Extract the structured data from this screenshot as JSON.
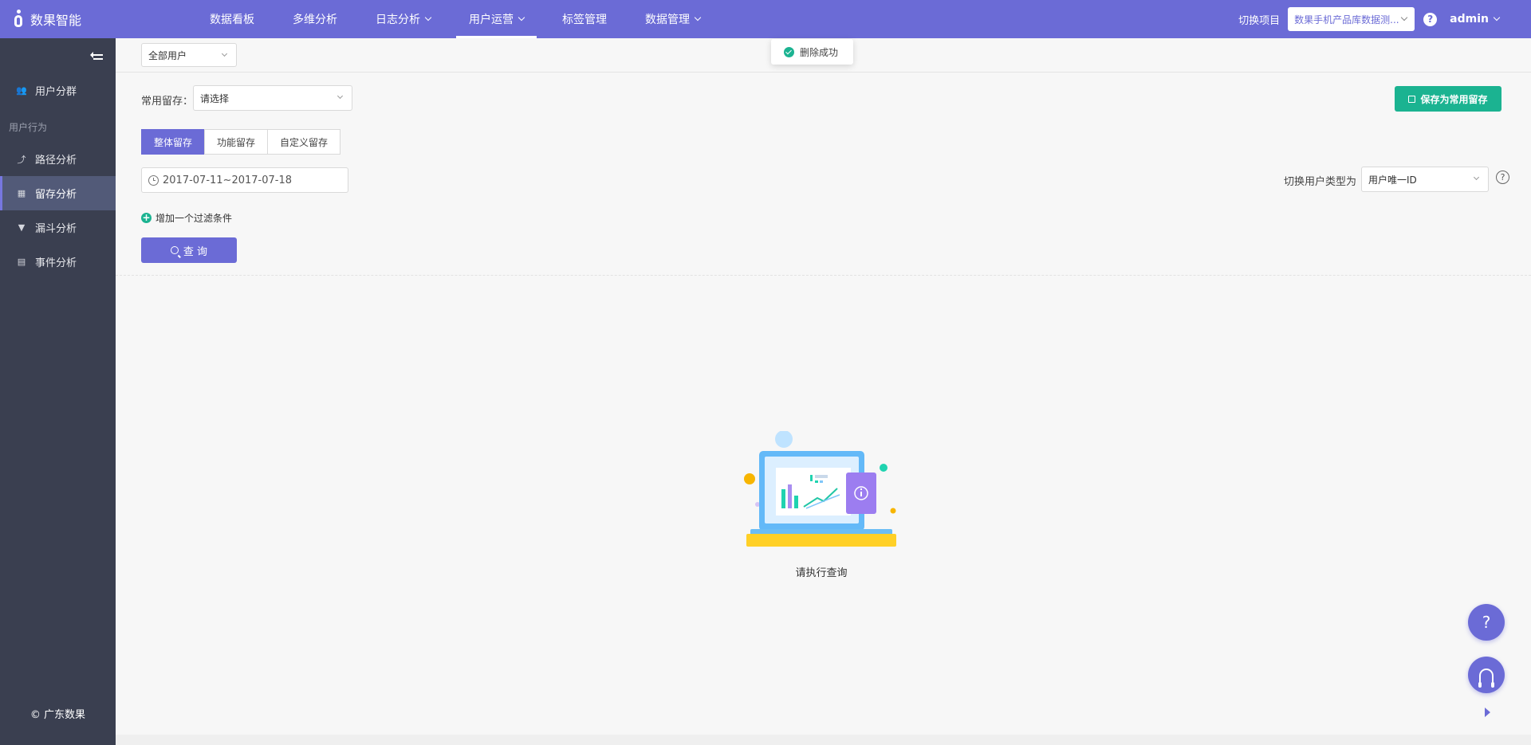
{
  "app": {
    "name": "数果智能"
  },
  "nav": {
    "items": [
      {
        "label": "数据看板",
        "has_dropdown": false,
        "active": false
      },
      {
        "label": "多维分析",
        "has_dropdown": false,
        "active": false
      },
      {
        "label": "日志分析",
        "has_dropdown": true,
        "active": false
      },
      {
        "label": "用户运营",
        "has_dropdown": true,
        "active": true
      },
      {
        "label": "标签管理",
        "has_dropdown": false,
        "active": false
      },
      {
        "label": "数据管理",
        "has_dropdown": true,
        "active": false
      }
    ]
  },
  "header_right": {
    "switch_project_label": "切换项目",
    "project_value": "数果手机产品库数据测...",
    "help_icon": "question-circle-icon",
    "user": "admin"
  },
  "sidebar": {
    "items": [
      {
        "label": "用户分群",
        "icon": "users-icon",
        "active": false
      },
      {
        "label": "路径分析",
        "icon": "path-icon",
        "active": false
      },
      {
        "label": "留存分析",
        "icon": "retention-icon",
        "active": true
      },
      {
        "label": "漏斗分析",
        "icon": "funnel-icon",
        "active": false
      },
      {
        "label": "事件分析",
        "icon": "event-icon",
        "active": false
      }
    ],
    "group_label": "用户行为",
    "copyright": "© 广东数果"
  },
  "toolbar": {
    "user_filter": "全部用户"
  },
  "toast": {
    "message": "删除成功",
    "icon": "check-circle-icon"
  },
  "form": {
    "common_retention_label": "常用留存：",
    "common_retention_placeholder": "请选择",
    "save_button": "保存为常用留存",
    "tabs": [
      {
        "label": "整体留存",
        "active": true
      },
      {
        "label": "功能留存",
        "active": false
      },
      {
        "label": "自定义留存",
        "active": false
      }
    ],
    "date_range": "2017-07-11~2017-07-18",
    "user_type_label": "切换用户类型为",
    "user_type_value": "用户唯一ID",
    "add_filter": "增加一个过滤条件",
    "query_button": "查 询"
  },
  "empty_state": {
    "text": "请执行查询"
  },
  "colors": {
    "primary": "#6b6bd6",
    "success": "#1bb391",
    "sidebar_bg": "#3a3f50"
  }
}
